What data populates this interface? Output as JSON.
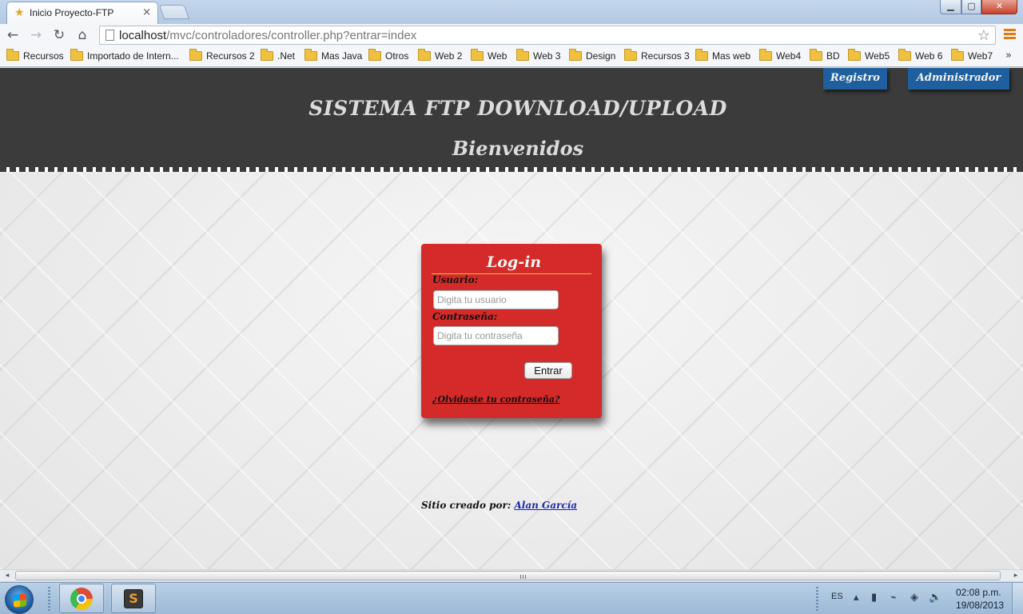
{
  "browser": {
    "tab_title": "Inicio Proyecto-FTP",
    "tab_close": "×",
    "window_buttons": {
      "minimize": "▁",
      "maximize": "▢",
      "close": "✕"
    },
    "nav": {
      "back": "←",
      "forward": "→",
      "reload": "↻",
      "home": "⌂"
    },
    "url_host": "localhost",
    "url_path": "/mvc/controladores/controller.php?entrar=index",
    "star": "☆",
    "bookmarks": [
      "Recursos",
      "Importado de Intern...",
      "Recursos 2",
      ".Net",
      "Mas Java",
      "Otros",
      "Web 2",
      "Web",
      "Web 3",
      "Design",
      "Recursos 3",
      "Mas web",
      "Web4",
      "BD",
      "Web5",
      "Web 6",
      "Web7"
    ],
    "bookmarks_more": "»"
  },
  "header": {
    "registro_label": "Registro",
    "admin_label": "Administrador",
    "title": "SISTEMA FTP DOWNLOAD/UPLOAD",
    "subtitle": "Bienvenidos"
  },
  "login": {
    "title": "Log-in",
    "user_label": "Usuario:",
    "user_placeholder": "Digita tu usuario",
    "pass_label": "Contraseña:",
    "pass_placeholder": "Digita tu contraseña",
    "submit_label": "Entrar",
    "forgot_label": "¿Olvidaste tu contraseña?"
  },
  "footer": {
    "credit_prefix": "Sitio creado por: ",
    "author": "Alan García"
  },
  "scrollbar": {
    "left": "◂",
    "right": "▸"
  },
  "taskbar": {
    "sublime_glyph": "S",
    "lang": "ES",
    "tray_icons": {
      "arrow": "▴",
      "signal": "▮",
      "power": "⌁",
      "network": "◈",
      "volume": "🔈"
    },
    "time": "02:08 p.m.",
    "date": "19/08/2013"
  },
  "colors": {
    "header_bg": "#3b3b3b",
    "header_buttons": "#1f5f9e",
    "login_card": "#d42a2a",
    "title_rule": "#f0c020",
    "author_link": "#1b27b0"
  }
}
